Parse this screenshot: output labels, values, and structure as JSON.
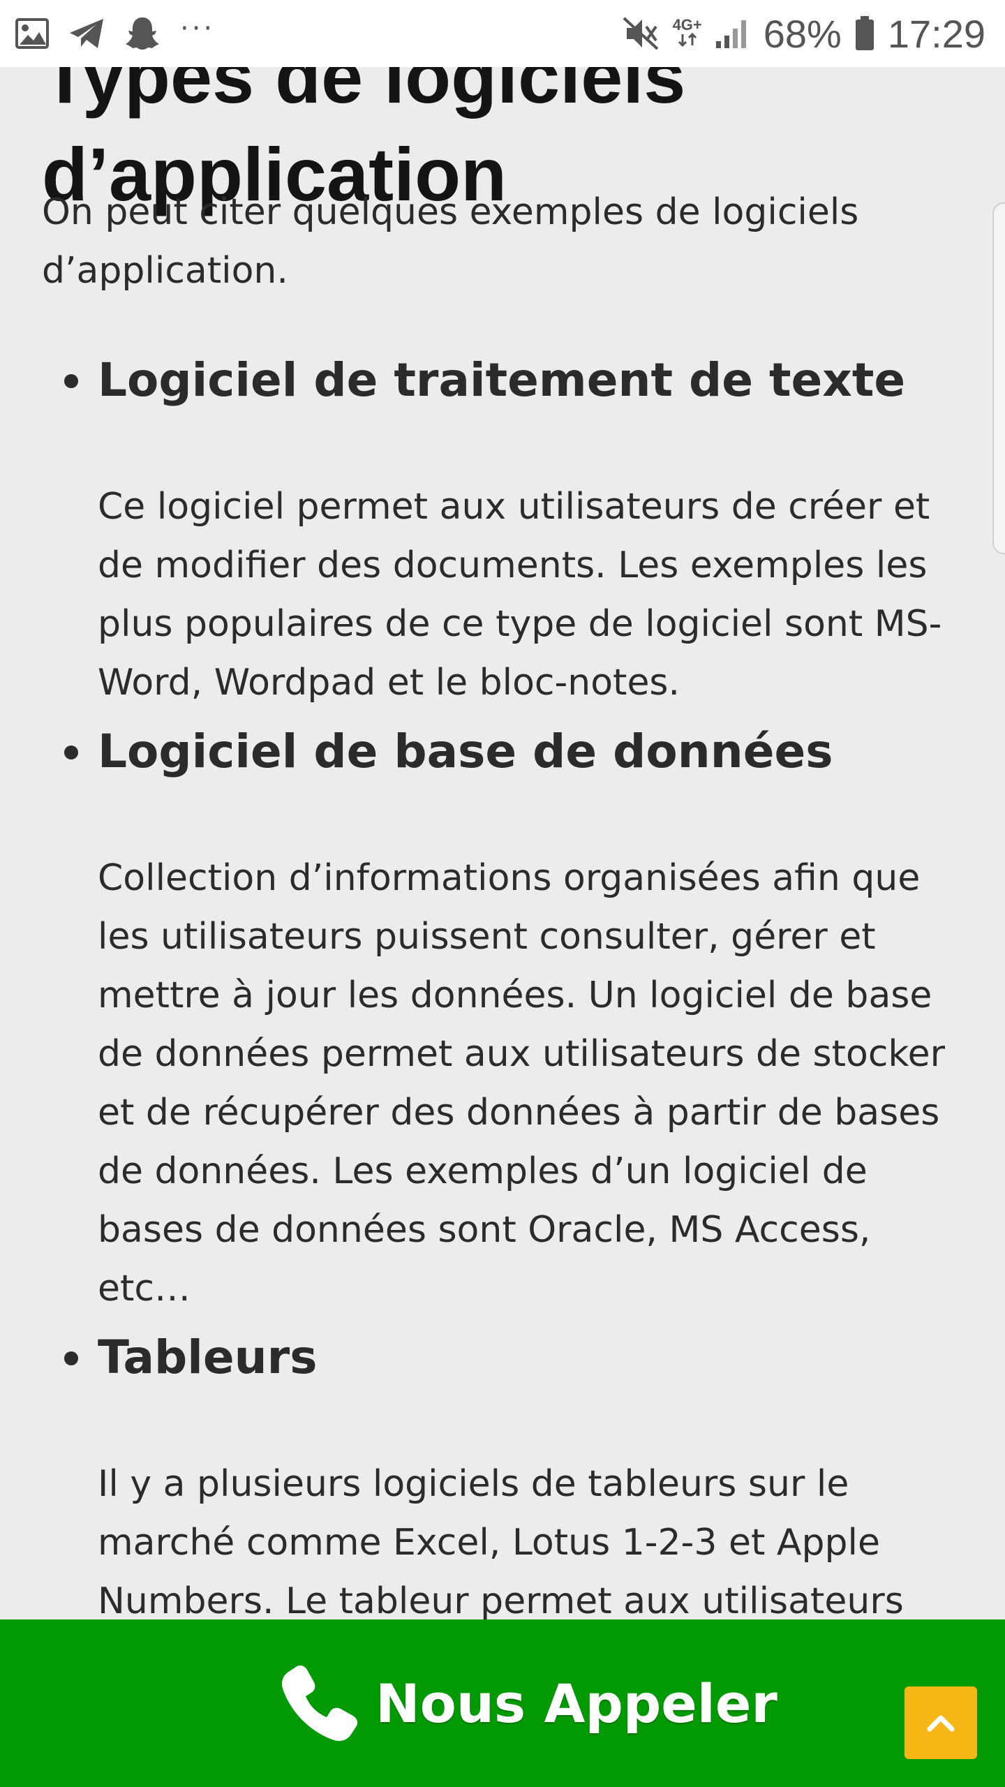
{
  "status_bar": {
    "battery_percent": "68%",
    "time": "17:29",
    "network": "4G+",
    "more": "···",
    "icons": [
      "gallery-icon",
      "telegram-icon",
      "snapchat-icon",
      "more-icon",
      "mute-icon",
      "network-4g-icon",
      "signal-icon",
      "battery-icon"
    ]
  },
  "article": {
    "heading_previous_line": "Types de logiciels",
    "heading_current_line": "d’application",
    "intro": "On peut citer quelques exemples de logiciels d’application.",
    "items": [
      {
        "title": "Logiciel de traitement de texte",
        "description": "Ce logiciel permet aux utilisateurs de créer et de modifier des documents. Les exemples les plus populaires de ce type de logiciel sont MS-Word, Wordpad et le bloc-notes."
      },
      {
        "title": "Logiciel de base de données",
        "description": "Collection d’informations organisées afin que les utilisateurs puissent consulter, gérer et mettre à jour les données. Un logiciel de base de données permet aux utilisateurs de stocker et de récupérer des données à partir de bases de données. Les exemples d’un logiciel de bases de données sont Oracle, MS Access, etc…"
      },
      {
        "title": "Tableurs",
        "description": "Il y a plusieurs logiciels de tableurs sur le marché comme Excel, Lotus 1-2-3 et Apple Numbers. Le tableur permet aux utilisateurs"
      }
    ]
  },
  "call_bar": {
    "label": "Nous Appeler",
    "icon": "phone-icon",
    "background": "#029a03",
    "back_to_top_icon": "chevron-up-icon",
    "back_to_top_color": "#f7b717"
  }
}
